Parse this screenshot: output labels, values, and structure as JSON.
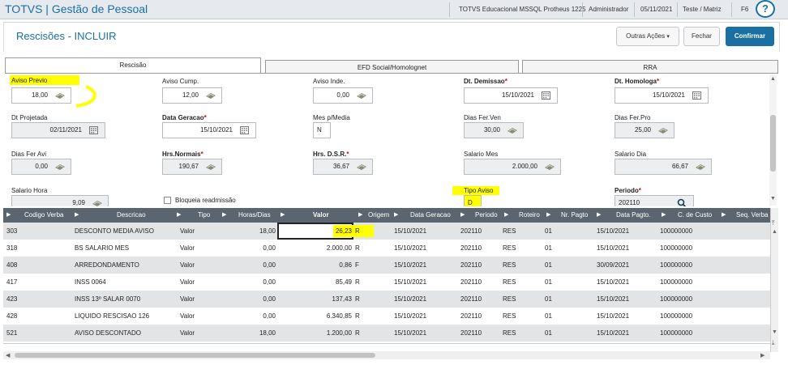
{
  "topbar": {
    "app_title": "TOTVS | Gestão de Pessoal",
    "environment": "TOTVS Educacional MSSQL Protheus 1225",
    "user": "Administrador",
    "date": "05/11/2021",
    "company": "Teste / Matriz",
    "shortcut": "F6"
  },
  "header": {
    "title": "Rescisões - INCLUIR",
    "outras_acoes_label": "Outras Ações",
    "fechar_label": "Fechar",
    "confirmar_label": "Confirmar"
  },
  "tabs": [
    {
      "label": "Rescisão"
    },
    {
      "label": "EFD Social/Homolognet"
    },
    {
      "label": "RRA"
    }
  ],
  "form": {
    "aviso_previo": {
      "label": "Aviso Previo",
      "value": "18,00"
    },
    "aviso_cump": {
      "label": "Aviso Cump.",
      "value": "12,00"
    },
    "aviso_inde": {
      "label": "Aviso Inde.",
      "value": "0,00"
    },
    "dt_demissao": {
      "label": "Dt. Demissao",
      "value": "15/10/2021"
    },
    "dt_homologa": {
      "label": "Dt. Homologa",
      "value": "15/10/2021"
    },
    "dt_projetada": {
      "label": "Dt Projetada",
      "value": "02/11/2021"
    },
    "data_geracao": {
      "label": "Data Geracao",
      "value": "15/10/2021"
    },
    "mes_p_media": {
      "label": "Mes p/Media",
      "value": "N"
    },
    "dias_fer_ven": {
      "label": "Dias Fer.Ven",
      "value": "30,00"
    },
    "dias_fer_pro": {
      "label": "Dias Fer.Pro",
      "value": "25,00"
    },
    "dias_fer_avi": {
      "label": "Dias Fer Avi",
      "value": "0,00"
    },
    "hrs_normais": {
      "label": "Hrs.Normais",
      "value": "190,67"
    },
    "hrs_dsr": {
      "label": "Hrs. D.S.R.",
      "value": "36,67"
    },
    "salario_mes": {
      "label": "Salario Mes",
      "value": "2.000,00"
    },
    "salario_dia": {
      "label": "Salario Dia",
      "value": "66,67"
    },
    "salario_hora": {
      "label": "Salario Hora",
      "value": "9,09"
    },
    "bloqueia_readmissao": {
      "label": "Bloqueia readmissão"
    },
    "tipo_aviso": {
      "label": "Tipo Aviso",
      "value": "D"
    },
    "periodo": {
      "label": "Periodo",
      "value": "202110"
    }
  },
  "grid": {
    "columns": [
      "Codigo Verba",
      "Descricao",
      "Tipo",
      "Horas/Dias",
      "Valor",
      "Origem",
      "Data Geracao",
      "Periodo",
      "Roteiro",
      "Nr. Pagto",
      "Data Pagto.",
      "C. de Custo",
      "Seq. Verba"
    ],
    "rows": [
      {
        "codigo": "303",
        "descricao": "DESCONTO MEDIA AVISO",
        "tipo": "Valor",
        "horas": "18,00",
        "valor": "26,23",
        "origem": "R",
        "data_geracao": "15/10/2021",
        "periodo": "202110",
        "roteiro": "RES",
        "nr_pagto": "01",
        "data_pagto": "15/10/2021",
        "custo": "100000000"
      },
      {
        "codigo": "318",
        "descricao": "BS SALARIO MES",
        "tipo": "Valor",
        "horas": "0,00",
        "valor": "2.000,00",
        "origem": "R",
        "data_geracao": "15/10/2021",
        "periodo": "202110",
        "roteiro": "RES",
        "nr_pagto": "01",
        "data_pagto": "15/10/2021",
        "custo": "100000000"
      },
      {
        "codigo": "408",
        "descricao": "ARREDONDAMENTO",
        "tipo": "Valor",
        "horas": "0,00",
        "valor": "0,86",
        "origem": "F",
        "data_geracao": "15/10/2021",
        "periodo": "202110",
        "roteiro": "RES",
        "nr_pagto": "01",
        "data_pagto": "30/09/2021",
        "custo": "100000000"
      },
      {
        "codigo": "417",
        "descricao": "INSS 0064",
        "tipo": "Valor",
        "horas": "0,00",
        "valor": "85,49",
        "origem": "R",
        "data_geracao": "15/10/2021",
        "periodo": "202110",
        "roteiro": "RES",
        "nr_pagto": "01",
        "data_pagto": "15/10/2021",
        "custo": "100000000"
      },
      {
        "codigo": "423",
        "descricao": "INSS 13º SALAR 0070",
        "tipo": "Valor",
        "horas": "0,00",
        "valor": "137,43",
        "origem": "R",
        "data_geracao": "15/10/2021",
        "periodo": "202110",
        "roteiro": "RES",
        "nr_pagto": "01",
        "data_pagto": "15/10/2021",
        "custo": "100000000"
      },
      {
        "codigo": "428",
        "descricao": "LIQUIDO RESCISAO 126",
        "tipo": "Valor",
        "horas": "0,00",
        "valor": "6.340,85",
        "origem": "R",
        "data_geracao": "15/10/2021",
        "periodo": "202110",
        "roteiro": "RES",
        "nr_pagto": "01",
        "data_pagto": "15/10/2021",
        "custo": "100000000"
      },
      {
        "codigo": "521",
        "descricao": "AVISO DESCONTADO",
        "tipo": "Valor",
        "horas": "18,00",
        "valor": "1.200,00",
        "origem": "R",
        "data_geracao": "15/10/2021",
        "periodo": "202110",
        "roteiro": "RES",
        "nr_pagto": "01",
        "data_pagto": "15/10/2021",
        "custo": "100000000"
      }
    ]
  },
  "colors": {
    "brand": "#1a6fa3",
    "highlight": "#ffff00",
    "grid_header": "#5a6570"
  }
}
